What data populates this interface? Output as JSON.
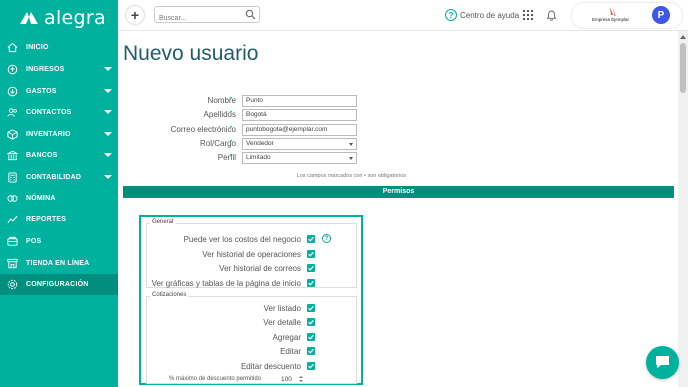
{
  "sidebar": {
    "brand": "alegra",
    "items": [
      {
        "label": "INICIO",
        "icon": "home-icon",
        "has_caret": false,
        "active": false
      },
      {
        "label": "INGRESOS",
        "icon": "income-icon",
        "has_caret": true,
        "active": false
      },
      {
        "label": "GASTOS",
        "icon": "expenses-icon",
        "has_caret": true,
        "active": false
      },
      {
        "label": "CONTACTOS",
        "icon": "contacts-icon",
        "has_caret": true,
        "active": false
      },
      {
        "label": "INVENTARIO",
        "icon": "inventory-icon",
        "has_caret": true,
        "active": false
      },
      {
        "label": "BANCOS",
        "icon": "bank-icon",
        "has_caret": true,
        "active": false
      },
      {
        "label": "CONTABILIDAD",
        "icon": "accounting-icon",
        "has_caret": true,
        "active": false
      },
      {
        "label": "NÓMINA",
        "icon": "payroll-icon",
        "has_caret": false,
        "active": false
      },
      {
        "label": "REPORTES",
        "icon": "reports-icon",
        "has_caret": false,
        "active": false
      },
      {
        "label": "POS",
        "icon": "pos-icon",
        "has_caret": false,
        "active": false
      },
      {
        "label": "TIENDA EN LÍNEA",
        "icon": "store-icon",
        "has_caret": false,
        "active": false
      },
      {
        "label": "CONFIGURACIÓN",
        "icon": "settings-icon",
        "has_caret": false,
        "active": true
      }
    ]
  },
  "topbar": {
    "add_label": "+",
    "search_placeholder": "Buscar...",
    "help_label": "Centro de ayuda",
    "company_name": "Empresa Ejemplar",
    "avatar_initial": "P"
  },
  "page": {
    "title": "Nuevo usuario"
  },
  "form": {
    "fields": [
      {
        "label": "Nombre",
        "value": "Punto",
        "type": "text"
      },
      {
        "label": "Apellidos",
        "value": "Bogotá",
        "type": "text"
      },
      {
        "label": "Correo electrónico",
        "value": "puntobogota@ejemplar.com",
        "type": "text"
      },
      {
        "label": "Rol/Cargo",
        "value": "Vendedor",
        "type": "select"
      },
      {
        "label": "Perfil",
        "value": "Limitado",
        "type": "select"
      }
    ],
    "required_mark": "•",
    "note": "Los campos marcados con • son obligatorios"
  },
  "permissions": {
    "bar_label": "Permisos",
    "general": {
      "legend": "General",
      "items": [
        {
          "label": "Puede ver los costos del negocio",
          "checked": true,
          "help": true
        },
        {
          "label": "Ver historial de operaciones",
          "checked": true,
          "help": false
        },
        {
          "label": "Ver historial de correos",
          "checked": true,
          "help": false
        },
        {
          "label": "Ver gráficas y tablas de la página de inicio",
          "checked": true,
          "help": false
        }
      ]
    },
    "quotes": {
      "legend": "Cotizaciones",
      "items": [
        {
          "label": "Ver listado",
          "checked": true
        },
        {
          "label": "Ver detalle",
          "checked": true
        },
        {
          "label": "Agregar",
          "checked": true
        },
        {
          "label": "Editar",
          "checked": true
        },
        {
          "label": "Editar descuento",
          "checked": true
        }
      ],
      "max_discount_label": "% máximo de descuento permitido",
      "max_discount_value": "100"
    }
  },
  "colors": {
    "brand": "#00b19d",
    "brand_dark": "#008f7e",
    "avatar": "#3e57e5"
  }
}
